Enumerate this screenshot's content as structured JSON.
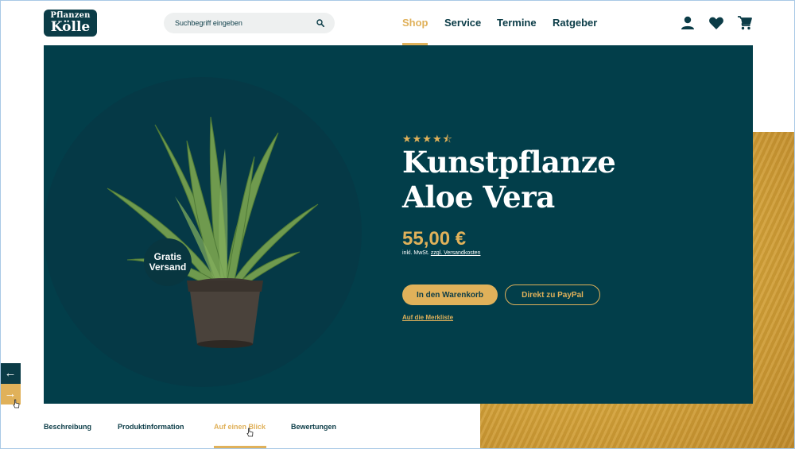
{
  "header": {
    "logo": {
      "line1": "Pflanzen",
      "line2": "Kölle"
    },
    "search": {
      "placeholder": "Suchbegriff eingeben",
      "icon": "search-icon"
    },
    "nav": [
      {
        "label": "Shop",
        "active": true
      },
      {
        "label": "Service",
        "active": false
      },
      {
        "label": "Termine",
        "active": false
      },
      {
        "label": "Ratgeber",
        "active": false
      }
    ],
    "icons": [
      "account-icon",
      "heart-icon",
      "cart-icon"
    ]
  },
  "hero": {
    "rating": 4.5,
    "stars": "★★★★⯪",
    "badge": {
      "line1": "Gratis",
      "line2": "Versand"
    },
    "title": {
      "line1": "Kunstpflanze",
      "line2": "Aloe Vera"
    },
    "price": "55,00 €",
    "tax_note": "inkl. MwSt.",
    "shipping_link": "zzgl. Versandkosten",
    "cart_button": "In den Warenkorb",
    "paypal_button": "Direkt zu PayPal",
    "wishlist_link": "Auf die Merkliste"
  },
  "slider": {
    "prev_icon": "arrow-left-icon",
    "next_icon": "arrow-right-icon",
    "prev_glyph": "←",
    "next_glyph": "→"
  },
  "tabs": [
    {
      "label": "Beschreibung",
      "active": false
    },
    {
      "label": "Produktinformation",
      "active": false
    },
    {
      "label": "Auf einen Blick",
      "active": true
    },
    {
      "label": "Bewertungen",
      "active": false
    }
  ],
  "colors": {
    "primary": "#0b3c47",
    "hero_bg": "#023e4a",
    "accent": "#e0b15a",
    "white": "#ffffff"
  }
}
